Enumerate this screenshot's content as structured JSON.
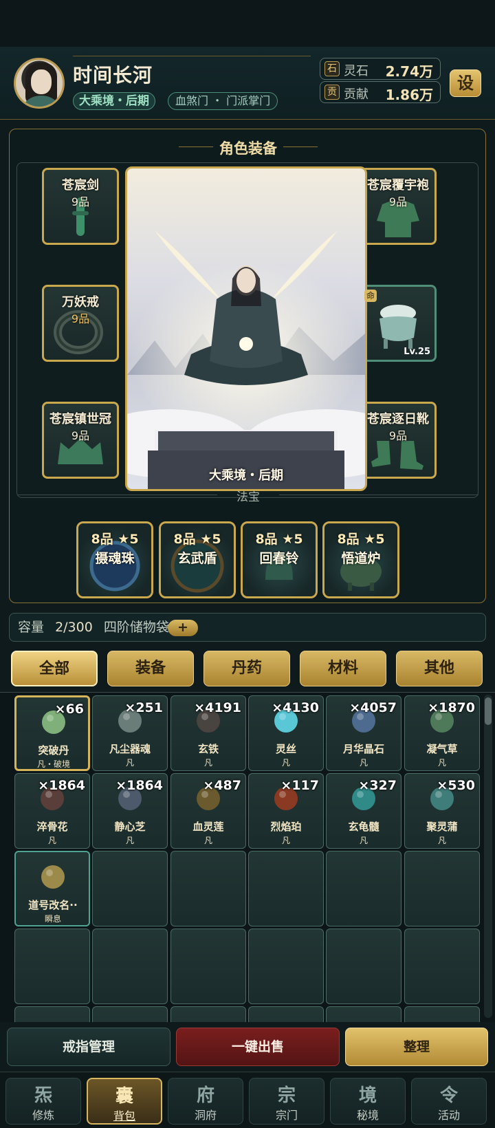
{
  "player": {
    "name": "时间长河",
    "realm": "大乘境・后期",
    "sect": "血煞门 ・ 门派掌门"
  },
  "resources": [
    {
      "icon_char": "石",
      "label": "灵石",
      "value": "2.74万"
    },
    {
      "icon_char": "贡",
      "label": "贡献",
      "value": "1.86万"
    }
  ],
  "settings_label": "设",
  "equipment": {
    "title": "角色装备",
    "slots": [
      {
        "name": "苍宸剑",
        "grade": "9品"
      },
      {
        "name": "苍宸覆宇袍",
        "grade": "9品"
      },
      {
        "name": "万妖戒",
        "grade": "9品"
      },
      {
        "name": "",
        "grade": "",
        "badge": "命",
        "level": "Lv.25"
      },
      {
        "name": "苍宸镇世冠",
        "grade": "9品"
      },
      {
        "name": "苍宸逐日靴",
        "grade": "9品"
      }
    ],
    "portrait_caption": "大乘境・后期",
    "treasure_label": "法宝",
    "treasures": [
      {
        "grade": "8品 ★5",
        "name": "摄魂珠"
      },
      {
        "grade": "8品 ★5",
        "name": "玄武盾"
      },
      {
        "grade": "8品 ★5",
        "name": "回春铃"
      },
      {
        "grade": "8品 ★5",
        "name": "悟道炉"
      }
    ]
  },
  "storage": {
    "label": "容量",
    "count": "2/300",
    "bag": "四阶储物袋",
    "plus": "+"
  },
  "tabs": [
    "全部",
    "装备",
    "丹药",
    "材料",
    "其他"
  ],
  "items": [
    {
      "qty": "×66",
      "name": "突破丹",
      "rank": "凡・破境",
      "icon": "planet-pill-icon",
      "color": "#7fb07a"
    },
    {
      "qty": "×251",
      "name": "凡尘器魂",
      "rank": "凡",
      "icon": "sword-soul-icon",
      "color": "#6b7d79"
    },
    {
      "qty": "×4191",
      "name": "玄铁",
      "rank": "凡",
      "icon": "iron-ore-icon",
      "color": "#4a4440"
    },
    {
      "qty": "×4130",
      "name": "灵丝",
      "rank": "凡",
      "icon": "spirit-silk-icon",
      "color": "#59c7d6"
    },
    {
      "qty": "×4057",
      "name": "月华晶石",
      "rank": "凡",
      "icon": "moon-crystal-icon",
      "color": "#4d6b8f"
    },
    {
      "qty": "×1870",
      "name": "凝气草",
      "rank": "凡",
      "icon": "herb-icon",
      "color": "#4f7a5a"
    },
    {
      "qty": "×1864",
      "name": "淬骨花",
      "rank": "凡",
      "icon": "bone-flower-icon",
      "color": "#5a3e3a"
    },
    {
      "qty": "×1864",
      "name": "静心芝",
      "rank": "凡",
      "icon": "mushroom-icon",
      "color": "#4c5a6b"
    },
    {
      "qty": "×487",
      "name": "血灵莲",
      "rank": "凡",
      "icon": "blood-lotus-icon",
      "color": "#6b5a2e"
    },
    {
      "qty": "×117",
      "name": "烈焰珀",
      "rank": "凡",
      "icon": "flame-amber-icon",
      "color": "#8a3a22"
    },
    {
      "qty": "×327",
      "name": "玄龟髓",
      "rank": "凡",
      "icon": "turtle-marrow-icon",
      "color": "#2f8a88"
    },
    {
      "qty": "×530",
      "name": "聚灵蒲",
      "rank": "凡",
      "icon": "spirit-reed-icon",
      "color": "#3f7d7a"
    },
    {
      "qty": "",
      "name": "道号改名··",
      "rank": "瞬息",
      "icon": "rename-card-icon",
      "color": "#9c8a4a"
    }
  ],
  "actions": [
    "戒指管理",
    "一键出售",
    "整理"
  ],
  "nav": [
    {
      "glyph": "炁",
      "label": "修炼"
    },
    {
      "glyph": "囊",
      "label": "背包"
    },
    {
      "glyph": "府",
      "label": "洞府"
    },
    {
      "glyph": "宗",
      "label": "宗门"
    },
    {
      "glyph": "境",
      "label": "秘境"
    },
    {
      "glyph": "令",
      "label": "活动"
    }
  ]
}
